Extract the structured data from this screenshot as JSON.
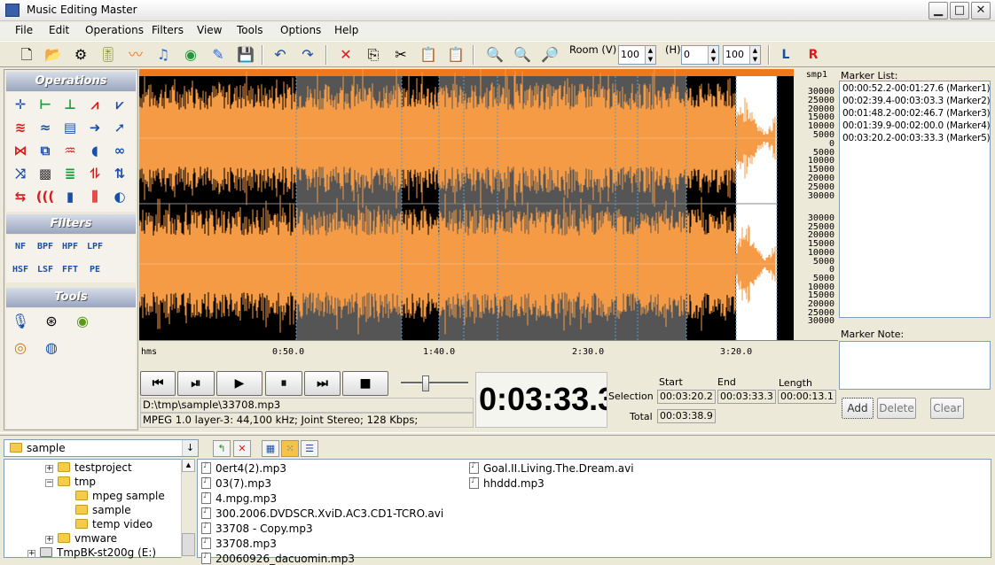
{
  "window": {
    "title": "Music Editing Master",
    "min_label": "▁",
    "max_label": "□",
    "close_label": "✕"
  },
  "menu": [
    "File",
    "Edit",
    "Operations",
    "Filters",
    "View",
    "Tools",
    "Options",
    "Help"
  ],
  "toolbar": {
    "room_v_label": "Room (V)",
    "room_v_value": "100",
    "h_label": "(H)",
    "h_value": "0",
    "h_value2": "100",
    "left_channel": "L",
    "right_channel": "R"
  },
  "panels": {
    "operations": "Operations",
    "filters": "Filters",
    "tools": "Tools"
  },
  "filters": [
    "NF",
    "BPF",
    "HPF",
    "LPF",
    "HSF",
    "LSF",
    "FFT",
    "PE"
  ],
  "ruler": {
    "unit": "smp1",
    "top_channel": [
      "30000",
      "25000",
      "20000",
      "15000",
      "10000",
      "5000",
      "0",
      "5000",
      "10000",
      "15000",
      "20000",
      "25000",
      "30000"
    ],
    "bottom_channel": [
      "30000",
      "25000",
      "20000",
      "15000",
      "10000",
      "5000",
      "0",
      "5000",
      "10000",
      "15000",
      "20000",
      "25000",
      "30000"
    ]
  },
  "timeline": {
    "unit": "hms",
    "labels": [
      "0:50.0",
      "1:40.0",
      "2:30.0",
      "3:20.0"
    ]
  },
  "markers": {
    "list_label": "Marker List:",
    "items": [
      "00:00:52.2-00:01:27.6 (Marker1)",
      "00:02:39.4-00:03:03.3 (Marker2)",
      "00:01:48.2-00:02:46.7 (Marker3)",
      "00:01:39.9-00:02:00.0 (Marker4)",
      "00:03:20.2-00:03:33.3 (Marker5)"
    ],
    "note_label": "Marker Note:",
    "add_label": "Add",
    "delete_label": "Delete",
    "clear_label": "Clear"
  },
  "player": {
    "file_path": "D:\\tmp\\sample\\33708.mp3",
    "format_info": "MPEG 1.0 layer-3: 44,100 kHz; Joint Stereo; 128 Kbps;",
    "current_time": "0:03:33.3",
    "volume_level": 0.35
  },
  "selection": {
    "start_label": "Start",
    "end_label": "End",
    "length_label": "Length",
    "selection_label": "Selection",
    "total_label": "Total",
    "start": "00:03:20.2",
    "end": "00:03:33.3",
    "length": "00:00:13.1",
    "total": "00:03:38.9"
  },
  "browser": {
    "folder": "sample",
    "tree": [
      "testproject",
      "tmp",
      "mpeg sample",
      "sample",
      "temp video",
      "vmware",
      "TmpBK-st200g (E:)"
    ],
    "files_col1": [
      "0ert4(2).mp3",
      "03(7).mp3",
      "4.mpg.mp3",
      "300.2006.DVDSCR.XviD.AC3.CD1-TCRO.avi",
      "33708 - Copy.mp3",
      "33708.mp3",
      "20060926_dacuomin.mp3"
    ],
    "files_col2": [
      "Goal.II.Living.The.Dream.avi",
      "hhddd.mp3"
    ]
  },
  "colors": {
    "wave": "#f59a45",
    "wave_selected": "#ff8a1e",
    "selection_region": "#555555",
    "accent_blue": "#1a4fa8",
    "accent_red": "#d81c1c"
  }
}
